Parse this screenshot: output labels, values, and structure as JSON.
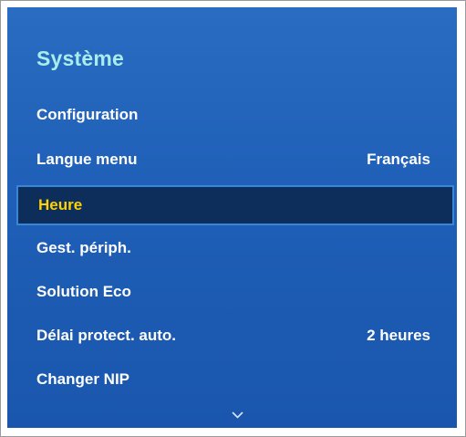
{
  "menu": {
    "title": "Système",
    "items": [
      {
        "label": "Configuration",
        "value": ""
      },
      {
        "label": "Langue menu",
        "value": "Français"
      },
      {
        "label": "Heure",
        "value": ""
      },
      {
        "label": "Gest. périph.",
        "value": ""
      },
      {
        "label": "Solution Eco",
        "value": ""
      },
      {
        "label": "Délai protect. auto.",
        "value": "2 heures"
      },
      {
        "label": "Changer NIP",
        "value": ""
      }
    ],
    "selected_index": 2,
    "scroll_indicator_icon": "chevron-down-icon"
  },
  "colors": {
    "panel_background": "#1f5fb7",
    "title": "#a8ecec",
    "item_text": "#ffffff",
    "selected_text": "#ffd200",
    "selected_background": "#0d2d5a",
    "selected_border": "#3a86d6"
  }
}
